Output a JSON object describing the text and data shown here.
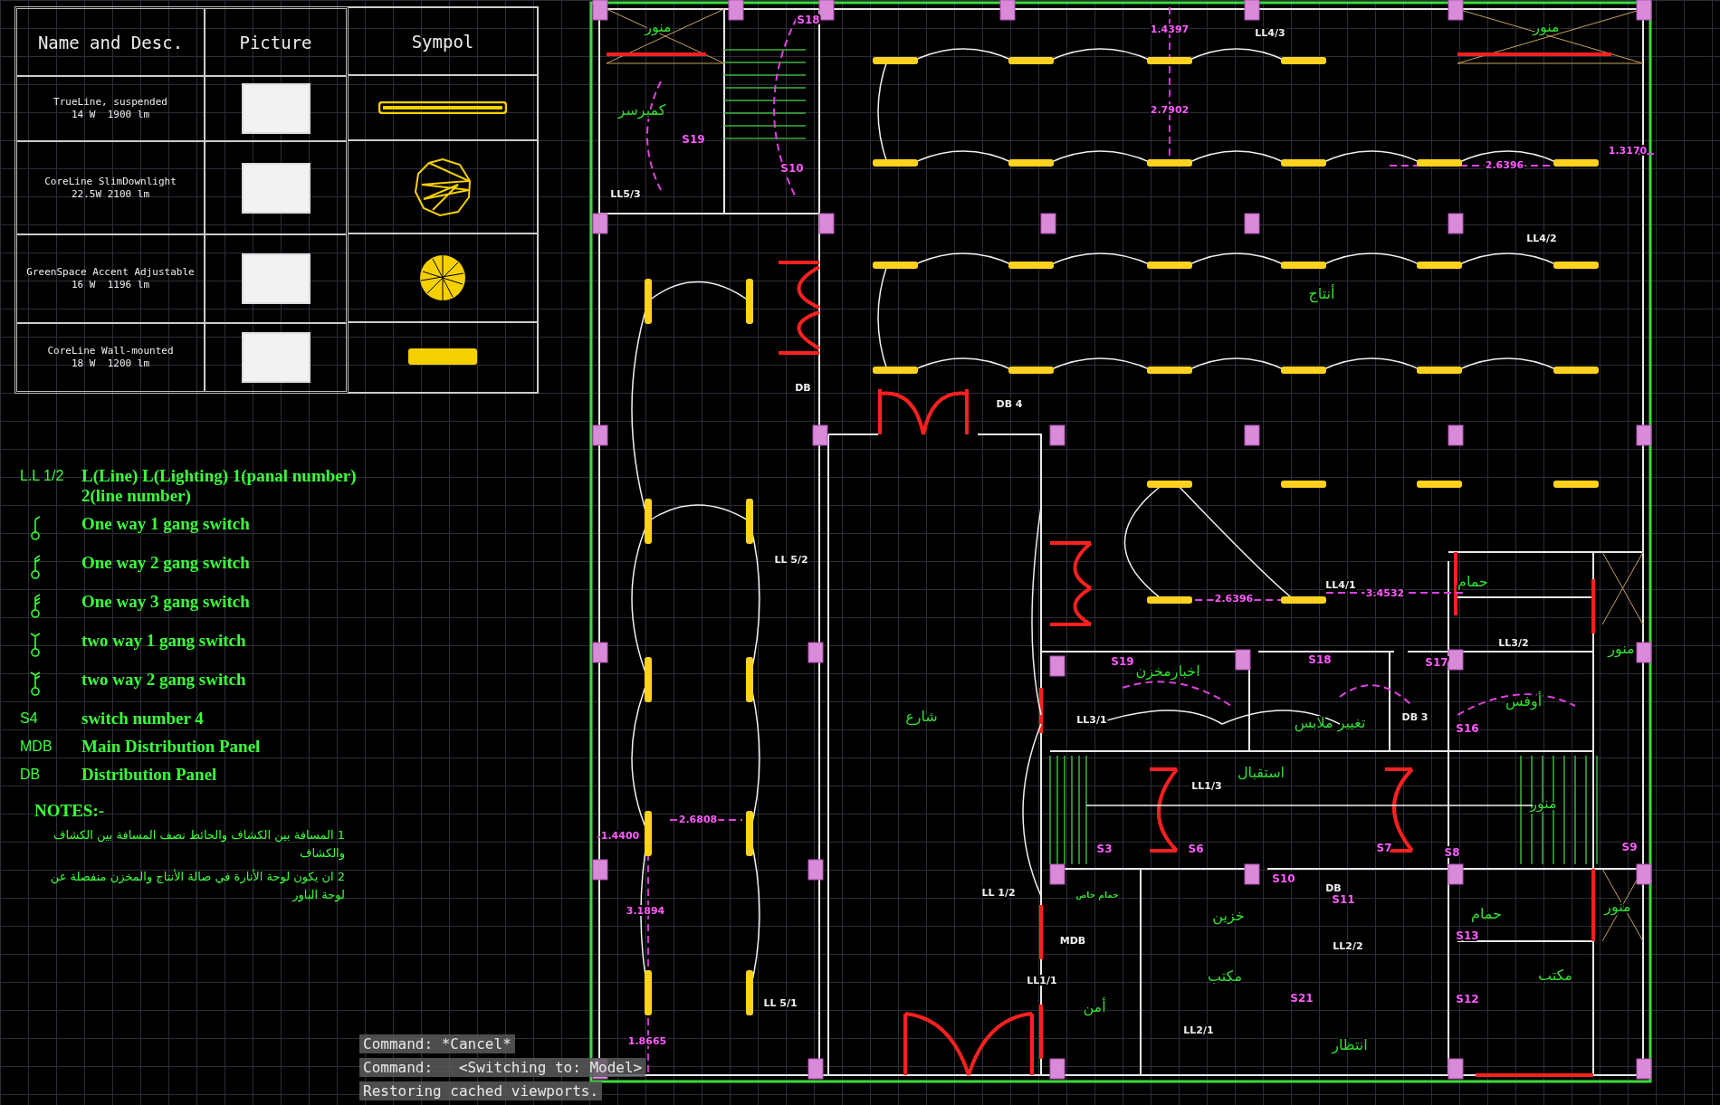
{
  "legend_table": {
    "columns": [
      "Name and Desc.",
      "Picture",
      "Sympol"
    ],
    "rows": [
      {
        "name": "TrueLine, suspended",
        "spec": "14 W  1900 lm",
        "kind": "linear"
      },
      {
        "name": "CoreLine SlimDownlight",
        "spec": "22.5W 2100 lm",
        "kind": "downlight"
      },
      {
        "name": "GreenSpace Accent Adjustable",
        "spec": "16 W  1196 lm",
        "kind": "accent"
      },
      {
        "name": "CoreLine Wall-mounted",
        "spec": "18 W  1200 lm",
        "kind": "wall"
      }
    ]
  },
  "legend": [
    {
      "kind": "code",
      "code": "L.L 1/2",
      "lines": [
        "L(Line) L(Lighting) 1(panal number)",
        "2(line number)"
      ]
    },
    {
      "kind": "switch",
      "lines": [
        "One way 1 gang switch"
      ]
    },
    {
      "kind": "switch",
      "lines": [
        "One way 2 gang switch"
      ]
    },
    {
      "kind": "switch",
      "lines": [
        "One way 3 gang switch"
      ]
    },
    {
      "kind": "switch",
      "lines": [
        "two way 1 gang switch"
      ]
    },
    {
      "kind": "switch",
      "lines": [
        "two way 2 gang switch"
      ]
    },
    {
      "kind": "code",
      "code": "S4",
      "lines": [
        "switch number 4"
      ]
    },
    {
      "kind": "code",
      "code": "MDB",
      "lines": [
        "Main Distribution Panel"
      ]
    },
    {
      "kind": "code",
      "code": "DB",
      "lines": [
        "Distribution Panel"
      ]
    }
  ],
  "notes": {
    "title": "NOTES:-",
    "items": [
      "1 المسافة بين الكشاف والحائط نصف المسافة بين الكشاف والكشاف",
      "2 ان يكون لوحة الأنارة في صالة الأنتاج والمخزن منفصلة عن لوحة الباور"
    ]
  },
  "plan_labels": [
    {
      "text": "1.4397",
      "kind": "dimension"
    },
    {
      "text": "2.7902",
      "kind": "dimension"
    },
    {
      "text": "LL4/3",
      "kind": "circuit"
    },
    {
      "text": "1.3170",
      "kind": "dimension"
    },
    {
      "text": "2.6396",
      "kind": "dimension"
    },
    {
      "text": "LL4/2",
      "kind": "circuit"
    },
    {
      "text": "أنتاج",
      "kind": "room"
    },
    {
      "text": "S18",
      "kind": "switch"
    },
    {
      "text": "S19",
      "kind": "switch"
    },
    {
      "text": "S10",
      "kind": "switch"
    },
    {
      "text": "كمبرسر",
      "kind": "room"
    },
    {
      "text": "LL5/3",
      "kind": "circuit"
    },
    {
      "text": "منور",
      "kind": "room"
    },
    {
      "text": "منور",
      "kind": "room"
    },
    {
      "text": "DB",
      "kind": "panel"
    },
    {
      "text": "DB 4",
      "kind": "panel"
    },
    {
      "text": "LL 5/2",
      "kind": "circuit"
    },
    {
      "text": "LL 5/1",
      "kind": "circuit"
    },
    {
      "text": "2.6808",
      "kind": "dimension"
    },
    {
      "text": "1.4400",
      "kind": "dimension"
    },
    {
      "text": "3.1894",
      "kind": "dimension"
    },
    {
      "text": "1.8665",
      "kind": "dimension"
    },
    {
      "text": "شارع",
      "kind": "room"
    },
    {
      "text": "2.6396",
      "kind": "dimension"
    },
    {
      "text": "LL4/1",
      "kind": "circuit"
    },
    {
      "text": "3.4532",
      "kind": "dimension"
    },
    {
      "text": "حمام",
      "kind": "room"
    },
    {
      "text": "LL3/2",
      "kind": "circuit"
    },
    {
      "text": "منور",
      "kind": "room"
    },
    {
      "text": "S19",
      "kind": "switch"
    },
    {
      "text": "اخبارمخزن",
      "kind": "room"
    },
    {
      "text": "S18",
      "kind": "switch"
    },
    {
      "text": "S17",
      "kind": "switch"
    },
    {
      "text": "LL3/1",
      "kind": "circuit"
    },
    {
      "text": "تغيير ملابس",
      "kind": "room"
    },
    {
      "text": "DB 3",
      "kind": "panel"
    },
    {
      "text": "أوفس",
      "kind": "room"
    },
    {
      "text": "S16",
      "kind": "switch"
    },
    {
      "text": "استقبال",
      "kind": "room"
    },
    {
      "text": "LL1/3",
      "kind": "circuit"
    },
    {
      "text": "منور",
      "kind": "room"
    },
    {
      "text": "S3",
      "kind": "switch"
    },
    {
      "text": "S6",
      "kind": "switch"
    },
    {
      "text": "S7",
      "kind": "switch"
    },
    {
      "text": "S8",
      "kind": "switch"
    },
    {
      "text": "S9",
      "kind": "switch"
    },
    {
      "text": "LL 1/2",
      "kind": "circuit"
    },
    {
      "text": "حمام خاص",
      "kind": "small-room"
    },
    {
      "text": "S10",
      "kind": "switch"
    },
    {
      "text": "S11",
      "kind": "switch"
    },
    {
      "text": "DB",
      "kind": "panel"
    },
    {
      "text": "خزين",
      "kind": "room"
    },
    {
      "text": "حمام",
      "kind": "room"
    },
    {
      "text": "منور",
      "kind": "room"
    },
    {
      "text": "S13",
      "kind": "switch"
    },
    {
      "text": "MDB",
      "kind": "panel"
    },
    {
      "text": "LL2/2",
      "kind": "circuit"
    },
    {
      "text": "LL1/1",
      "kind": "circuit"
    },
    {
      "text": "مكتب",
      "kind": "room"
    },
    {
      "text": "مكتب",
      "kind": "room"
    },
    {
      "text": "أمن",
      "kind": "room"
    },
    {
      "text": "S21",
      "kind": "switch"
    },
    {
      "text": "S12",
      "kind": "switch"
    },
    {
      "text": "LL2/1",
      "kind": "circuit"
    },
    {
      "text": "انتظار",
      "kind": "room"
    }
  ],
  "command_line": [
    "Command: *Cancel*",
    "Command:   <Switching to: Model>",
    "Restoring cached viewports."
  ]
}
